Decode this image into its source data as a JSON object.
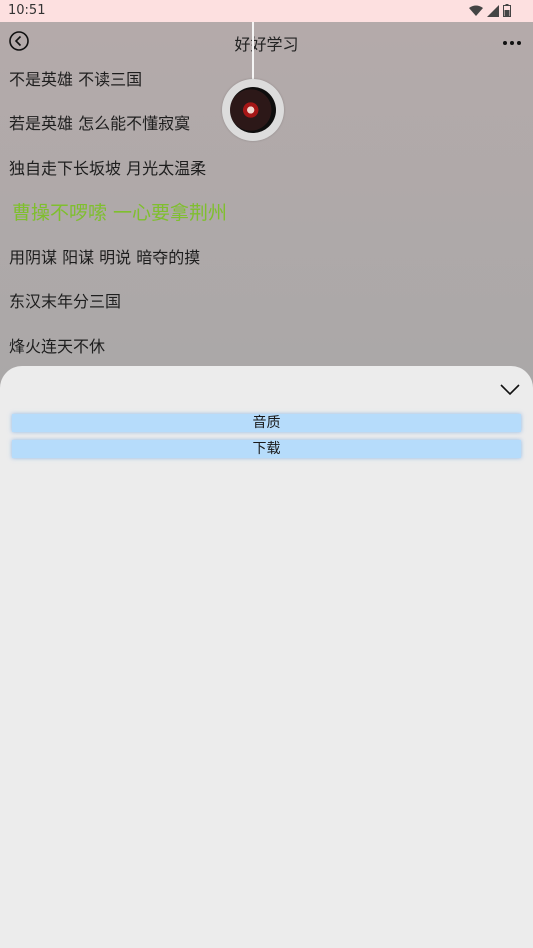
{
  "status_bar": {
    "time": "10:51"
  },
  "header": {
    "title": "好好学习"
  },
  "lyrics": {
    "lines": [
      "不是英雄 不读三国",
      "若是英雄 怎么能不懂寂寞",
      "独自走下长坂坡 月光太温柔",
      "曹操不啰嗦 一心要拿荆州",
      "用阴谋 阳谋 明说 暗夺的摸",
      "东汉末年分三国",
      "烽火连天不休"
    ],
    "current_index": 3
  },
  "colors": {
    "current_lyric": "#7fbf2e",
    "sheet_button_bg": "#b6dcfb",
    "sheet_bg": "#ececec"
  },
  "sheet": {
    "options": [
      {
        "label": "音质"
      },
      {
        "label": "下载"
      }
    ]
  },
  "icons": [
    "back-icon",
    "more-icon",
    "wifi-icon",
    "cellular-icon",
    "battery-icon",
    "chevron-down-icon"
  ]
}
